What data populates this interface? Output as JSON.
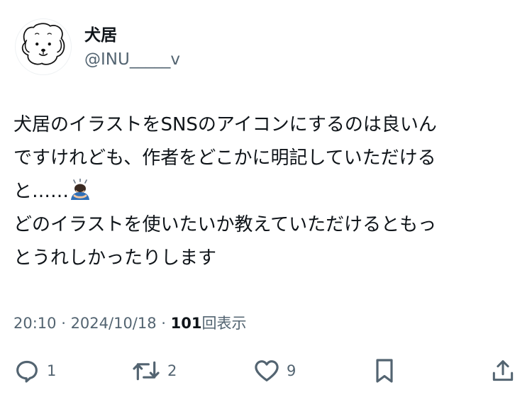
{
  "user": {
    "display_name": "犬居",
    "handle": "@INU_____v",
    "avatar_icon": "dog-avatar-icon"
  },
  "tweet": {
    "lines": [
      "犬居のイラストをSNSのアイコンにするのは良いん",
      "ですけれども、作者をどこかに明記していただける",
      "と……",
      "どのイラストを使いたいか教えていただけるともっ",
      "とうれしかったりします"
    ],
    "emoji": "bowing-person-emoji"
  },
  "meta": {
    "time": "20:10",
    "sep1": " · ",
    "date": "2024/10/18",
    "sep2": " · ",
    "views_count": "101",
    "views_label": "回表示"
  },
  "actions": {
    "reply": {
      "icon": "reply-icon",
      "count": "1"
    },
    "retweet": {
      "icon": "retweet-icon",
      "count": "2"
    },
    "like": {
      "icon": "heart-icon",
      "count": "9"
    },
    "bookmark": {
      "icon": "bookmark-icon"
    },
    "share": {
      "icon": "share-icon"
    }
  },
  "colors": {
    "text_primary": "#0f1419",
    "text_secondary": "#536471",
    "background": "#ffffff"
  }
}
